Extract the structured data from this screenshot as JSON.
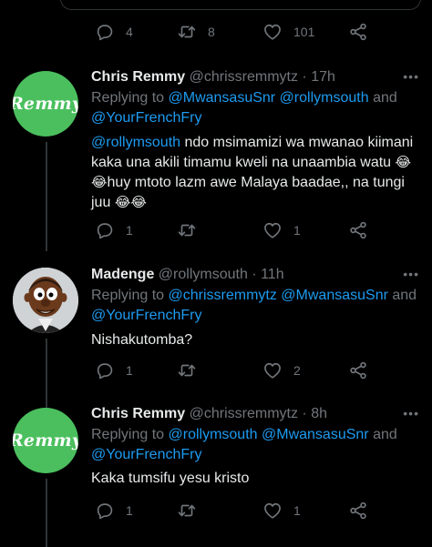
{
  "top_actions": {
    "replies": "4",
    "retweets": "8",
    "likes": "101"
  },
  "tweets": [
    {
      "avatar_text": "Remmy",
      "name": "Chris Remmy",
      "handle": "@chrissremmytz",
      "sep": "·",
      "time": "17h",
      "replying_label": "Replying to",
      "reply_1": "@MwansasuSnr @rollymsouth",
      "reply_and": "and",
      "reply_2": "@YourFrenchFry",
      "body_mention": "@rollymsouth",
      "body_1": " ndo msimamizi wa mwanao kiimani",
      "body_2": "kaka una akili timamu kweli na unaambia watu",
      "body_3": "huy mtoto lazm awe Malaya baadae,, na tungi",
      "body_4": "juu",
      "emoji": "😂",
      "replies": "1",
      "retweets": "",
      "likes": "1"
    },
    {
      "name": "Madenge",
      "handle": "@rollymsouth",
      "sep": "·",
      "time": "11h",
      "replying_label": "Replying to",
      "reply_1": "@chrissremmytz @MwansasuSnr",
      "reply_and": "and",
      "reply_2": "@YourFrenchFry",
      "body": "Nishakutomba?",
      "replies": "1",
      "retweets": "",
      "likes": "2"
    },
    {
      "avatar_text": "Remmy",
      "name": "Chris Remmy",
      "handle": "@chrissremmytz",
      "sep": "·",
      "time": "8h",
      "replying_label": "Replying to",
      "reply_1": "@rollymsouth @MwansasuSnr",
      "reply_and": "and",
      "reply_2": "@YourFrenchFry",
      "body": "Kaka tumsifu yesu kristo",
      "replies": "1",
      "retweets": "",
      "likes": "1"
    }
  ],
  "more_label": "•••",
  "icons": [
    "reply-icon",
    "retweet-icon",
    "like-icon",
    "share-icon",
    "more-icon"
  ],
  "colors": {
    "background": "#000000",
    "text": "#e7e9ea",
    "muted": "#71767b",
    "link": "#1d9bf0",
    "avatar_green": "#4bbf5e",
    "divider": "#2f3336"
  }
}
